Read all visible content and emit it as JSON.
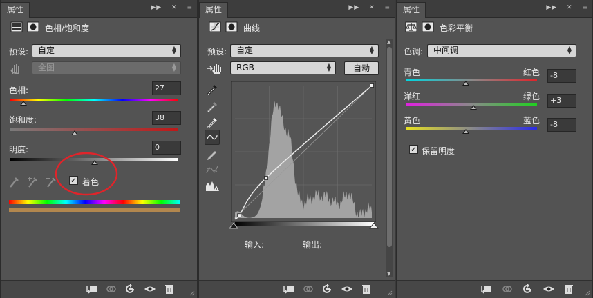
{
  "panel_tab_label": "属性",
  "colors": {
    "panel_bg": "#535353",
    "field_bg": "#d6d6d6",
    "annotation_red": "#e0242a",
    "colorize_swatch": "#b2874e"
  },
  "hue_sat": {
    "title": "色相/饱和度",
    "preset_label": "预设:",
    "preset_value": "自定",
    "channel_value": "全图",
    "hue_label": "色相:",
    "hue_value": "27",
    "saturation_label": "饱和度:",
    "saturation_value": "38",
    "lightness_label": "明度:",
    "lightness_value": "0",
    "colorize_label": "着色",
    "colorize_checked": true
  },
  "curves": {
    "title": "曲线",
    "preset_label": "预设:",
    "preset_value": "自定",
    "channel_value": "RGB",
    "auto_label": "自动",
    "input_label": "输入:",
    "output_label": "输出:",
    "curve_points": [
      [
        0,
        0
      ],
      [
        8,
        5
      ],
      [
        58,
        77
      ],
      [
        255,
        255
      ]
    ]
  },
  "color_balance": {
    "title": "色彩平衡",
    "tone_label": "色调:",
    "tone_value": "中间调",
    "cyan_label": "青色",
    "red_label": "红色",
    "cyan_red_value": "-8",
    "magenta_label": "洋红",
    "green_label": "绿色",
    "magenta_green_value": "+3",
    "yellow_label": "黄色",
    "blue_label": "蓝色",
    "yellow_blue_value": "-8",
    "preserve_label": "保留明度",
    "preserve_checked": true
  }
}
